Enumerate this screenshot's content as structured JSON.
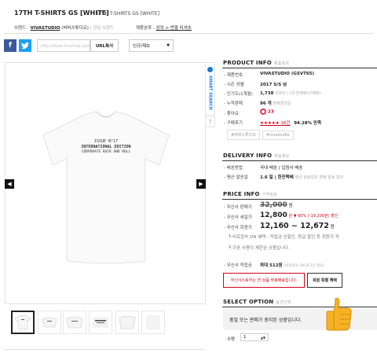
{
  "header": {
    "title": "17TH T-SHIRTS GS [WHITE]",
    "subtitle": "17TH T-SHIRTS GS [WHITE]",
    "brand_label": "브랜드 :",
    "brand_name": "VIVASTUDIO",
    "brand_sub": "(비바스튜디오)",
    "brand_more": "| 관심 브랜드",
    "category_label": "제품분류 :",
    "category_path": "상의 > 반팔 티셔츠"
  },
  "share": {
    "facebook": "f",
    "twitter": "t",
    "url_placeholder": "http://store.musinsa.com/app/...",
    "url_copy": "URL복사",
    "sort_value": "신규/제보",
    "sort_chevron": "▼"
  },
  "product_image": {
    "print_lines": [
      "ISSUE N°17",
      "INTERNATIONAL EDITION",
      "CORPORATE ROCK AND ROLL"
    ],
    "smart_search": "SMART SEARCH",
    "help": "?",
    "prev": "◀",
    "next": "▶"
  },
  "product_info": {
    "title": "PRODUCT INFO",
    "title_sub": "제품정보",
    "rows": [
      {
        "label": "- 제품번호",
        "value": "VIVASTUDIO (GSVT65)"
      },
      {
        "label": "- 시즌 성별",
        "value": "2017 S/S  남"
      },
      {
        "label": "- 인기도(1개월)",
        "value": "1,738",
        "extra": "조회수 | 23 판매량(구매량)"
      },
      {
        "label": "- 누적판매",
        "value": "96 개",
        "extra": "판매경과일"
      },
      {
        "label": "- 좋아요",
        "value": "23"
      },
      {
        "label": "- 구매후기",
        "value": "★★★★★ 16건",
        "extra": "94.28% 만족"
      }
    ],
    "tags": [
      "#비바스튜디오",
      "#vivastudio"
    ]
  },
  "delivery_info": {
    "title": "DELIVERY INFO",
    "title_sub": "배송정보",
    "rows": [
      {
        "label": "- 배송방법",
        "value": "국내 배송 | 입점사 배송"
      },
      {
        "label": "- 평균 발송일",
        "value": "1.6 일 | 한진택배",
        "extra": "평균 발송일은 판매 발송 일자"
      }
    ]
  },
  "price_info": {
    "title": "PRICE INFO",
    "title_sub": "가격정보",
    "original_label": "- 무신사 판매가",
    "original_price": "32,000",
    "won": "원",
    "sale_label": "- 무신사 세일가",
    "sale_price": "12,800",
    "sale_note": "원 ▼ 60% (-19,200원) 할인",
    "member_label": "- 무신사 회원가",
    "member_price": "12,160 ~ 12,672",
    "member_won": "원",
    "info_line1": "┗ 비로접속 ON 혜택 : 적립금 선할인, 등급 할인 등 회원가 적",
    "info_line2": "┗ 쿠폰 사용이 제한된 상품입니다.",
    "point_label": "- 무신사 적립금",
    "point_value": "최대 512원",
    "point_extra": "(비로접속 ON 로그인 필요)",
    "free_ship_button": "무신사스토어는 전 상품 무료배송입니다.",
    "member_button": "회원 특별 혜택"
  },
  "select_option": {
    "title": "SELECT OPTION",
    "title_sub": "옵션선택",
    "sold_out": "품절 또는 판매가 중지된 상품입니다.",
    "qty_label": "수량",
    "qty_value": "1",
    "qty_controls": "▲▼"
  },
  "colors": {
    "accent_red": "#d0021b",
    "accent_blue": "#1a7bd5",
    "facebook": "#3b5998",
    "twitter": "#1da1f2",
    "thumbs_up": "#f5b324"
  }
}
